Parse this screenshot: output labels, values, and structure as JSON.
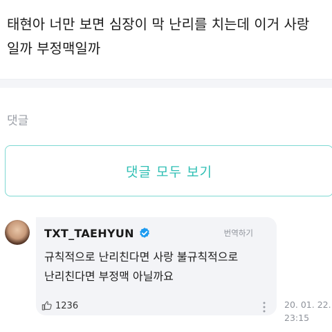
{
  "post": {
    "title": "태현아 너만 보면 심장이 막 난리를 치는데 이거 사랑\n일까 부정맥일까"
  },
  "comments_section": {
    "label": "댓글",
    "view_all_label": "댓글 모두 보기"
  },
  "comment": {
    "author": "TXT_TAEHYUN",
    "translate_label": "번역하기",
    "body": "규칙적으로 난리친다면 사랑 불규칙적으로\n난리친다면 부정맥 아닐까요",
    "likes": "1236",
    "timestamp": "20. 01. 22.\n23:15"
  },
  "colors": {
    "accent": "#2fbfb4",
    "accent_border": "#7dd8d2",
    "verified": "#1d9bf0",
    "bubble_bg": "#f3f4f7"
  },
  "icons": {
    "verified": "verified-badge-icon",
    "like": "thumbs-up-icon",
    "more": "more-vertical-icon"
  }
}
